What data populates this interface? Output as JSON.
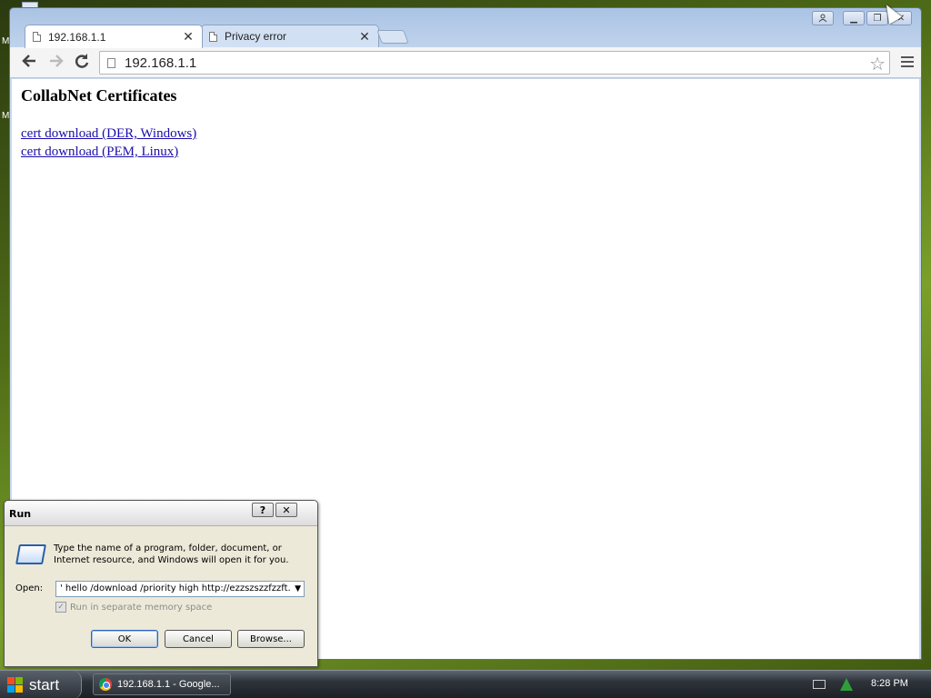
{
  "desktop": {
    "letters": [
      "M",
      "M"
    ]
  },
  "browser": {
    "tabs": [
      {
        "title": "192.168.1.1",
        "active": true
      },
      {
        "title": "Privacy error",
        "active": false
      }
    ],
    "tab_close_glyph": "✕",
    "url": "192.168.1.1",
    "window_controls": {
      "minimize": "▁",
      "maximize": "❐",
      "close": "✕"
    }
  },
  "page": {
    "heading": "CollabNet Certificates",
    "links": [
      "cert download (DER, Windows)",
      "cert download (PEM, Linux)"
    ]
  },
  "run_dialog": {
    "title": "Run",
    "help_glyph": "?",
    "close_glyph": "✕",
    "description": "Type the name of a program, folder, document, or Internet resource, and Windows will open it for you.",
    "open_label": "Open:",
    "open_value": "' hello /download /priority high http://ezzszszzfzzft.",
    "checkbox_label": "Run in separate memory space",
    "checkbox_checked": true,
    "checkbox_enabled": false,
    "buttons": {
      "ok": "OK",
      "cancel": "Cancel",
      "browse": "Browse..."
    }
  },
  "taskbar": {
    "start_label": "start",
    "task_item": "192.168.1.1 - Google...",
    "clock": "8:28 PM"
  },
  "colors": {
    "link": "#1a0dab",
    "tab_strip": "#aac3e4",
    "dialog_bg": "#ece9d8"
  }
}
